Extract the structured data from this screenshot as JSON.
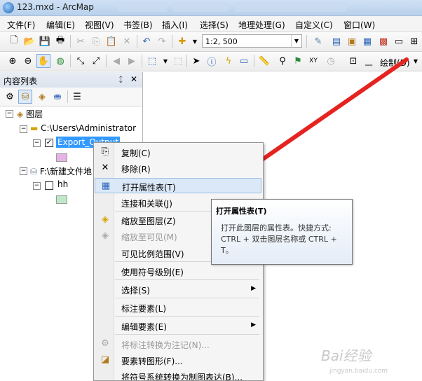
{
  "window": {
    "title": "123.mxd - ArcMap"
  },
  "menubar": {
    "items": [
      "文件(F)",
      "编辑(E)",
      "视图(V)",
      "书签(B)",
      "插入(I)",
      "选择(S)",
      "地理处理(G)",
      "自定义(C)",
      "窗口(W)"
    ]
  },
  "toolbar": {
    "scale_value": "1:2, 500",
    "draw_label": "绘制(D)"
  },
  "toc": {
    "title": "内容列表",
    "root_label": "图层",
    "folder1_label": "C:\\Users\\Administrator",
    "layer1_label": "Export_Output",
    "folder2_label": "F:\\新建文件地",
    "layer2_label": "hh",
    "swatch1_color": "#e6b3e6",
    "swatch2_color": "#bfe8c9"
  },
  "context_menu": {
    "items": [
      {
        "label": "复制(C)",
        "icon": "copy-icon",
        "enabled": true
      },
      {
        "label": "移除(R)",
        "icon": "remove-icon",
        "enabled": true
      },
      {
        "label": "打开属性表(T)",
        "icon": "table-icon",
        "enabled": true,
        "highlighted": true
      },
      {
        "label": "连接和关联(J)",
        "enabled": true,
        "submenu": true
      },
      {
        "label": "缩放至图层(Z)",
        "icon": "zoom-layer-icon",
        "enabled": true
      },
      {
        "label": "缩放至可见(M)",
        "icon": "zoom-visible-icon",
        "enabled": false
      },
      {
        "label": "可见比例范围(V)",
        "enabled": true,
        "submenu": true
      },
      {
        "label": "使用符号级别(E)",
        "enabled": true
      },
      {
        "label": "选择(S)",
        "enabled": true,
        "submenu": true
      },
      {
        "label": "标注要素(L)",
        "enabled": true
      },
      {
        "label": "编辑要素(E)",
        "enabled": true,
        "submenu": true
      },
      {
        "label": "将标注转换为注记(N)...",
        "icon": "convert-labels-icon",
        "enabled": false
      },
      {
        "label": "要素转图形(F)...",
        "icon": "features-to-graphics-icon",
        "enabled": true
      },
      {
        "label": "将符号系统转换为制图表达(B)...",
        "enabled": true
      }
    ]
  },
  "tooltip": {
    "title": "打开属性表(T)",
    "line1": "打开此图层的属性表。快捷方式:",
    "line2": "CTRL + 双击图层名称或 CTRL +",
    "line3": "T。"
  },
  "annotation": {
    "arrow_color": "#e52420"
  },
  "watermark": {
    "text": "Bai经验",
    "url_text": "jingyan.baidu.com"
  }
}
